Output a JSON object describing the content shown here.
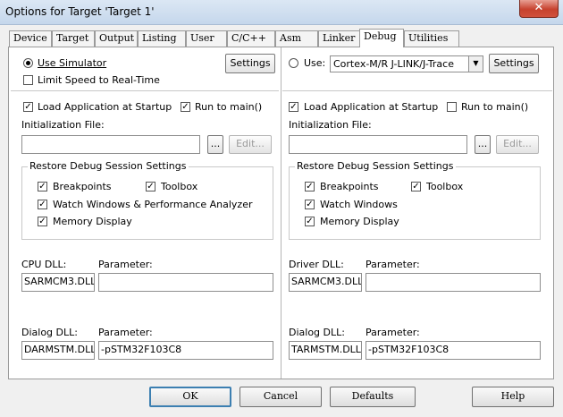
{
  "window": {
    "title": "Options for Target 'Target 1'",
    "close_glyph": "✕"
  },
  "tabs": [
    {
      "label": "Device"
    },
    {
      "label": "Target"
    },
    {
      "label": "Output"
    },
    {
      "label": "Listing"
    },
    {
      "label": "User"
    },
    {
      "label": "C/C++"
    },
    {
      "label": "Asm"
    },
    {
      "label": "Linker"
    },
    {
      "label": "Debug",
      "active": true
    },
    {
      "label": "Utilities"
    }
  ],
  "left": {
    "use_simulator": "Use Simulator",
    "limit_speed": "Limit Speed to Real-Time",
    "settings": "Settings",
    "load_app": "Load Application at Startup",
    "run_to_main": "Run to main()",
    "init_file_label": "Initialization File:",
    "init_file_value": "",
    "browse": "...",
    "edit": "Edit...",
    "restore_title": "Restore Debug Session Settings",
    "breakpoints": "Breakpoints",
    "toolbox": "Toolbox",
    "watch": "Watch Windows & Performance Analyzer",
    "memory": "Memory Display",
    "cpu_dll_label": "CPU DLL:",
    "cpu_param_label": "Parameter:",
    "cpu_dll_value": "SARMCM3.DLL",
    "cpu_param_value": "",
    "dialog_dll_label": "Dialog DLL:",
    "dialog_param_label": "Parameter:",
    "dialog_dll_value": "DARMSTM.DLL",
    "dialog_param_value": "-pSTM32F103C8"
  },
  "right": {
    "use_label": "Use:",
    "driver_select": "Cortex-M/R J-LINK/J-Trace",
    "settings": "Settings",
    "load_app": "Load Application at Startup",
    "run_to_main": "Run to main()",
    "init_file_label": "Initialization File:",
    "init_file_value": "",
    "browse": "...",
    "edit": "Edit...",
    "restore_title": "Restore Debug Session Settings",
    "breakpoints": "Breakpoints",
    "toolbox": "Toolbox",
    "watch": "Watch Windows",
    "memory": "Memory Display",
    "driver_dll_label": "Driver DLL:",
    "driver_param_label": "Parameter:",
    "driver_dll_value": "SARMCM3.DLL",
    "driver_param_value": "",
    "dialog_dll_label": "Dialog DLL:",
    "dialog_param_label": "Parameter:",
    "dialog_dll_value": "TARMSTM.DLL",
    "dialog_param_value": "-pSTM32F103C8"
  },
  "footer": {
    "ok": "OK",
    "cancel": "Cancel",
    "defaults": "Defaults",
    "help": "Help"
  },
  "check_glyph": "✓"
}
